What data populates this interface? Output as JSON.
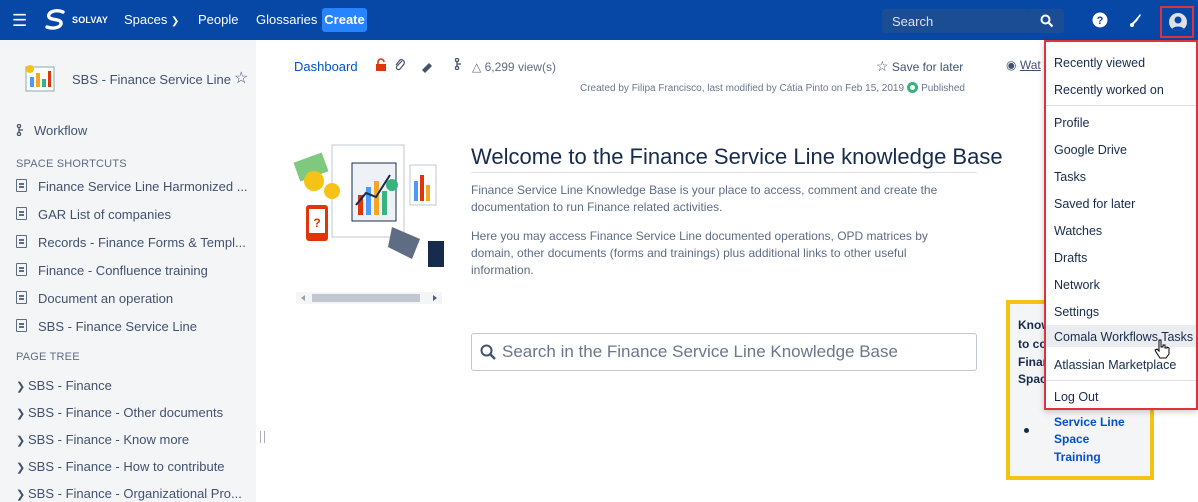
{
  "topnav": {
    "brand": "SOLVAY",
    "items": [
      "Spaces",
      "People",
      "Glossaries"
    ],
    "create_label": "Create",
    "search_placeholder": "Search"
  },
  "sidebar": {
    "space_title": "SBS - Finance Service Line",
    "workflow": "Workflow",
    "shortcuts_heading": "SPACE SHORTCUTS",
    "shortcuts": [
      "Finance Service Line Harmonized ...",
      "GAR List of companies",
      "Records - Finance Forms & Templ...",
      "Finance - Confluence training",
      "Document an operation",
      "SBS - Finance Service Line"
    ],
    "tree_heading": "PAGE TREE",
    "tree": [
      "SBS - Finance",
      "SBS - Finance - Other documents",
      "SBS - Finance - Know more",
      "SBS - Finance - How to contribute",
      "SBS - Finance - Organizational Pro..."
    ]
  },
  "content": {
    "breadcrumb": "Dashboard",
    "views": "6,299 view(s)",
    "save_for_later": "Save for later",
    "watch": "Wat",
    "byline": "Created by Filipa Francisco, last modified by Cátia Pinto on Feb 15, 2019",
    "status": "Published",
    "welcome": "Welcome to the Finance Service Line knowledge Base",
    "para1_line1": "Finance Service Line Knowledge Base is your place to access, comment and create the",
    "para1_line2": "documentation to run Finance related activities.",
    "para2_line1": "Here you may access Finance Service Line documented operations, OPD matrices by",
    "para2_line2": "domain, other documents (forms and trainings) plus additional links to other useful",
    "para2_line3": "information.",
    "search_placeholder": "Search in the Finance Service Line Knowledge Base"
  },
  "panel": {
    "lines": [
      "Know",
      "to co",
      "Finar",
      "Spac"
    ],
    "link_lines": [
      "Service Line",
      "Space",
      "Training"
    ]
  },
  "user_menu": {
    "items": [
      "Recently viewed",
      "Recently worked on",
      "Profile",
      "Google Drive",
      "Tasks",
      "Saved for later",
      "Watches",
      "Drafts",
      "Network",
      "Settings",
      "Comala Workflows Tasks",
      "Atlassian Marketplace",
      "Log Out"
    ],
    "highlighted": "Comala Workflows Tasks"
  },
  "colors": {
    "nav_bg": "#0747a6",
    "create_bg": "#2684ff",
    "highlight_border": "#e0323c",
    "panel_border": "#f5c216",
    "published": "#36b37e"
  }
}
